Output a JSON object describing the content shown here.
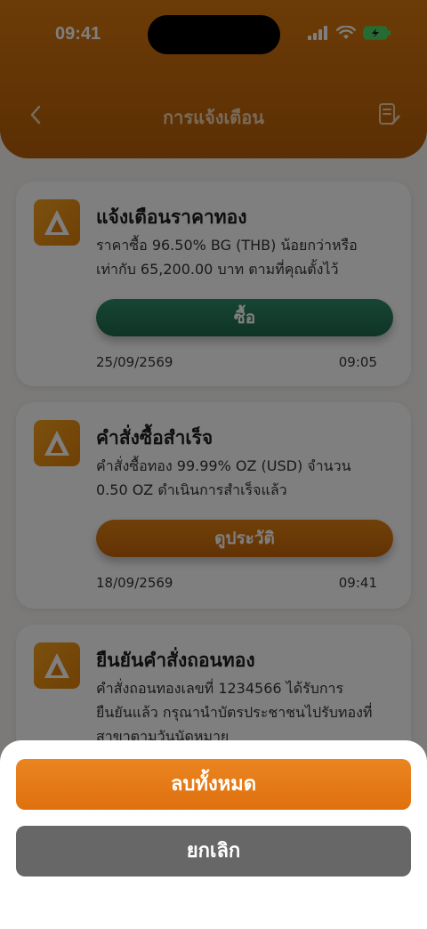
{
  "status_bar": {
    "time": "09:41"
  },
  "header": {
    "title": "การแจ้งเตือน"
  },
  "notifications": [
    {
      "title": "แจ้งเตือนราคาทอง",
      "body_line1": "ราคาซื้อ 96.50% BG (THB) น้อยกว่าหรือ",
      "body_line2": "เท่ากับ 65,200.00 บาท ตามที่คุณตั้งไว้",
      "button": "ซื้อ",
      "date": "25/09/2569",
      "time": "09:05"
    },
    {
      "title": "คำสั่งซื้อสำเร็จ",
      "body_line1": "คำสั่งซื้อทอง 99.99% OZ (USD) จำนวน",
      "body_line2": "0.50 OZ ดำเนินการสำเร็จแล้ว",
      "button": "ดูประวัติ",
      "date": "18/09/2569",
      "time": "09:41"
    },
    {
      "title": "ยืนยันคำสั่งถอนทอง",
      "body_line1": "คำสั่งถอนทองเลขที่ 1234566 ได้รับการ",
      "body_line2": "ยืนยันแล้ว กรุณานำบัตรประชาชนไปรับทองที่",
      "body_line3": "สาขาตามวันนัดหมาย"
    }
  ],
  "action_sheet": {
    "delete_all": "ลบทั้งหมด",
    "cancel": "ยกเลิก"
  },
  "colors": {
    "brand": "#d9780e",
    "green": "#2f8a67",
    "cancel": "#676767"
  }
}
